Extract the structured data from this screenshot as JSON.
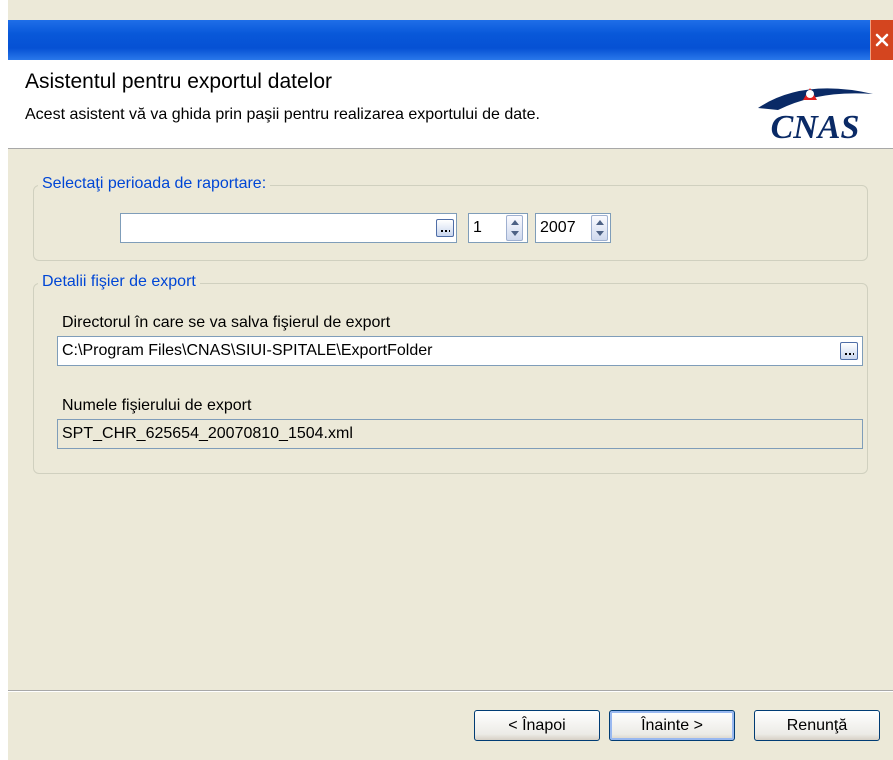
{
  "header": {
    "title": "Asistentul pentru exportul datelor",
    "subtitle": "Acest asistent vă va ghida prin paşii pentru realizarea exportului de date.",
    "logo_text": "CNAS"
  },
  "period_group": {
    "title": "Selectaţi perioada de raportare:",
    "period_value": "",
    "month_value": "1",
    "year_value": "2007"
  },
  "export_group": {
    "title": "Detalii fişier de export",
    "directory_label": "Directorul în care se va salva fişierul de export",
    "directory_value": "C:\\Program Files\\CNAS\\SIUI-SPITALE\\ExportFolder",
    "filename_label": "Numele fişierului de export",
    "filename_value": "SPT_CHR_625654_20070810_1504.xml"
  },
  "buttons": {
    "back": "< Înapoi",
    "next": "Înainte >",
    "cancel": "Renunţă"
  },
  "colors": {
    "title_bar": "#0858d9",
    "group_title": "#0046d5",
    "logo": "#0a2a66",
    "logo_accent": "#e02020",
    "close_button": "#d4451f"
  },
  "icons": {
    "close": "close-icon",
    "browse": "ellipsis-icon",
    "spin": "spin-updown-icon"
  }
}
